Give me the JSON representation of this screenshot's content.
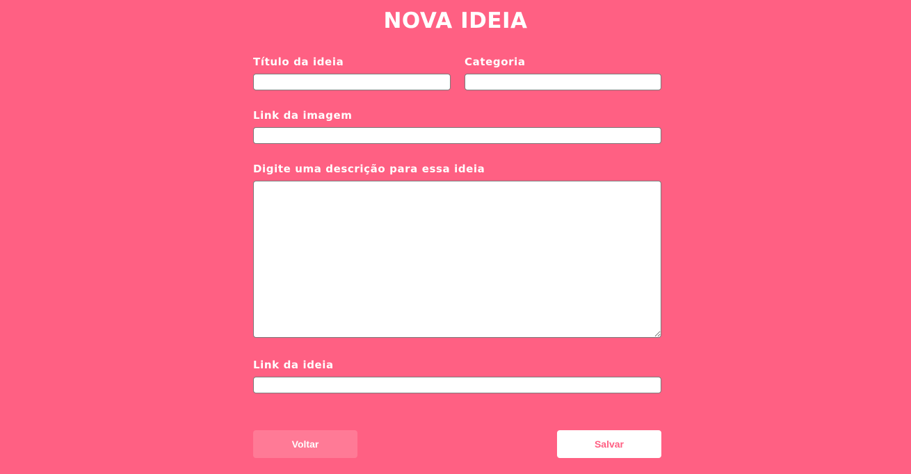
{
  "page": {
    "title": "NOVA IDEIA"
  },
  "form": {
    "title_label": "Título da ideia",
    "title_value": "",
    "category_label": "Categoria",
    "category_value": "",
    "image_link_label": "Link da imagem",
    "image_link_value": "",
    "description_label": "Digite uma descrição para essa ideia",
    "description_value": "",
    "idea_link_label": "Link da ideia",
    "idea_link_value": ""
  },
  "actions": {
    "back_label": "Voltar",
    "save_label": "Salvar"
  },
  "colors": {
    "background": "#ff6083",
    "back_button": "#ff7a96",
    "save_button": "#ffffff",
    "save_text": "#ff6083"
  }
}
